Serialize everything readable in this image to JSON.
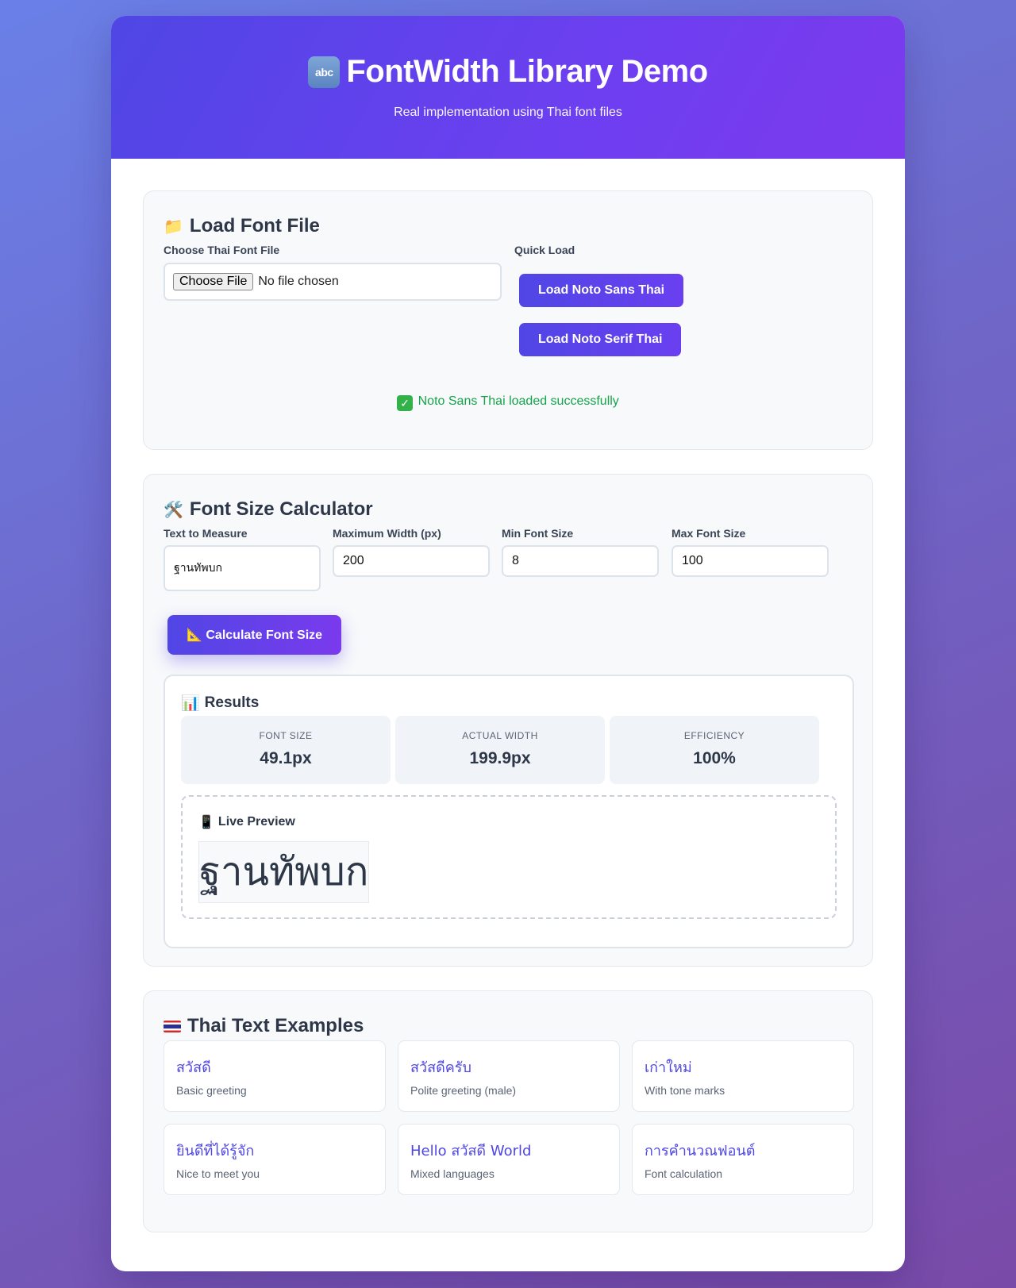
{
  "header": {
    "icon": "abc",
    "title": "FontWidth Library Demo",
    "subtitle": "Real implementation using Thai font files"
  },
  "load_section": {
    "emoji": "📁",
    "title": "Load Font File",
    "file_label": "Choose Thai Font File",
    "choose_button": "Choose File",
    "file_status": "No file chosen",
    "quick_label": "Quick Load",
    "btn_sans": "Load Noto Sans Thai",
    "btn_serif": "Load Noto Serif Thai",
    "status": "Noto Sans Thai loaded successfully"
  },
  "calculator": {
    "emoji": "🛠️",
    "title": "Font Size Calculator",
    "text_label": "Text to Measure",
    "text_value": "ฐานทัพบก",
    "width_label": "Maximum Width (px)",
    "width_value": "200",
    "min_label": "Min Font Size",
    "min_value": "8",
    "max_label": "Max Font Size",
    "max_value": "100",
    "calc_button": "Calculate Font Size",
    "calc_emoji": "📐"
  },
  "results": {
    "emoji": "📊",
    "title": "Results",
    "stats": [
      {
        "label": "Font Size",
        "value": "49.1px"
      },
      {
        "label": "Actual Width",
        "value": "199.9px"
      },
      {
        "label": "Efficiency",
        "value": "100%"
      }
    ],
    "preview_emoji": "📱",
    "preview_title": "Live Preview",
    "preview_text": "ฐานทัพบก"
  },
  "examples": {
    "title": "Thai Text Examples",
    "items": [
      {
        "text": "สวัสดี",
        "desc": "Basic greeting"
      },
      {
        "text": "สวัสดีครับ",
        "desc": "Polite greeting (male)"
      },
      {
        "text": "เก่าใหม่",
        "desc": "With tone marks"
      },
      {
        "text": "ยินดีที่ได้รู้จัก",
        "desc": "Nice to meet you"
      },
      {
        "text": "Hello สวัสดี World",
        "desc": "Mixed languages"
      },
      {
        "text": "การคำนวณฟอนต์",
        "desc": "Font calculation"
      }
    ]
  },
  "colors": {
    "accent": "#4f46e5",
    "success": "#16a34a"
  }
}
